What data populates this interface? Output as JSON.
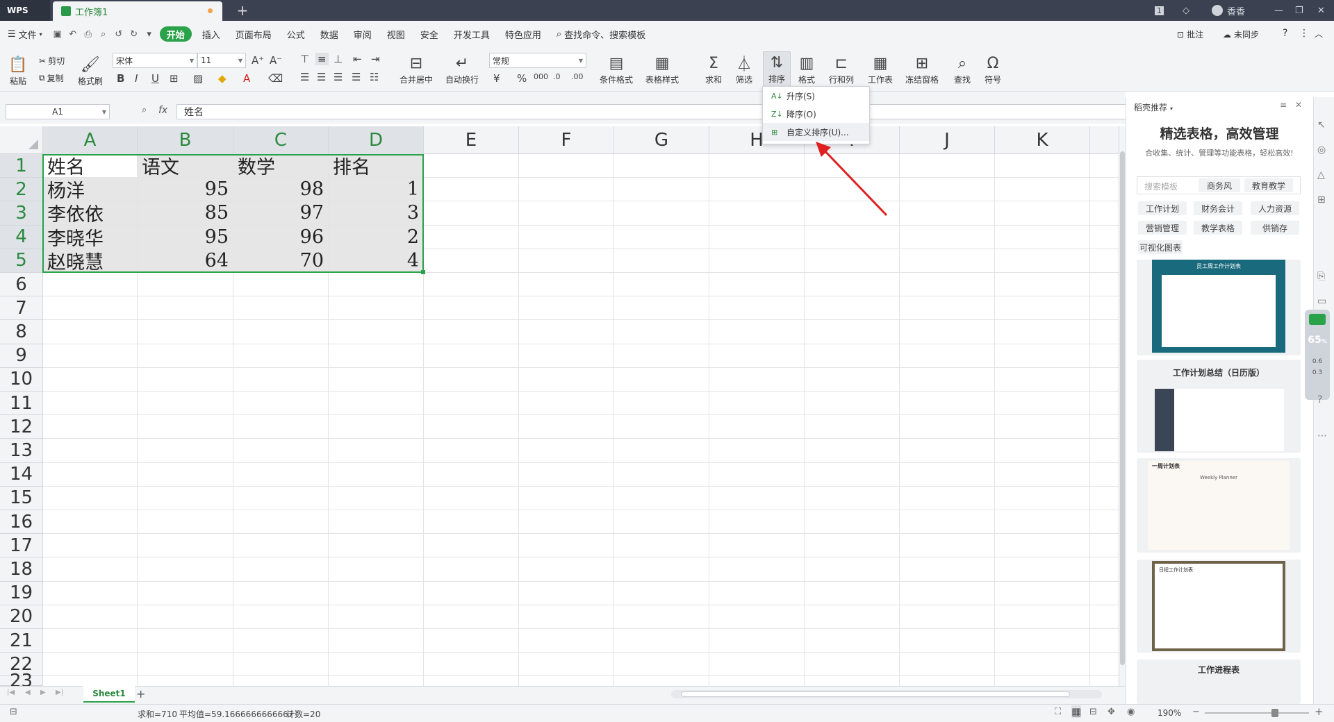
{
  "titlebar": {
    "app": "WPS",
    "doc_tab": "工作簿1",
    "new_tab": "+",
    "account": "香香",
    "badge": "1"
  },
  "menu": {
    "file": "文件",
    "tabs": [
      "开始",
      "插入",
      "页面布局",
      "公式",
      "数据",
      "审阅",
      "视图",
      "安全",
      "开发工具",
      "特色应用"
    ],
    "search": "查找命令、搜索模板",
    "comment": "批注",
    "sync": "未同步"
  },
  "ribbon": {
    "paste": "粘贴",
    "cut": "剪切",
    "copy": "复制",
    "format_painter": "格式刷",
    "font_name": "宋体",
    "font_size": "11",
    "merge": "合并居中",
    "wrap": "自动换行",
    "number_format": "常规",
    "cond_format": "条件格式",
    "table_style": "表格样式",
    "sum": "求和",
    "filter": "筛选",
    "sort": "排序",
    "format": "格式",
    "rowcol": "行和列",
    "worksheet": "工作表",
    "freeze": "冻结窗格",
    "find": "查找",
    "symbol": "符号"
  },
  "sort_menu": {
    "asc": "升序(S)",
    "desc": "降序(O)",
    "custom": "自定义排序(U)..."
  },
  "formula": {
    "cell_ref": "A1",
    "fx": "fx",
    "content": "姓名"
  },
  "columns": [
    "A",
    "B",
    "C",
    "D",
    "E",
    "F",
    "G",
    "H",
    "I",
    "J",
    "K"
  ],
  "rows": [
    "1",
    "2",
    "3",
    "4",
    "5",
    "6",
    "7",
    "8",
    "9",
    "10",
    "11",
    "12",
    "13",
    "14",
    "15",
    "16",
    "17",
    "18",
    "19",
    "20",
    "21",
    "22",
    "23"
  ],
  "sheet": {
    "header": [
      "姓名",
      "语文",
      "数学",
      "排名"
    ],
    "data": [
      [
        "杨洋",
        "95",
        "98",
        "1"
      ],
      [
        "李依依",
        "85",
        "97",
        "3"
      ],
      [
        "李晓华",
        "95",
        "96",
        "2"
      ],
      [
        "赵晓慧",
        "64",
        "70",
        "4"
      ]
    ]
  },
  "panel": {
    "header": "稻壳推荐",
    "title": "精选表格，高效管理",
    "subtitle": "合收集、统计、管理等功能表格，轻松高效!",
    "search_placeholder": "搜索模板",
    "tags": [
      "商务风",
      "教育教学",
      "工作计划",
      "财务会计",
      "人力资源",
      "营销管理",
      "教学表格",
      "供销存",
      "可视化图表"
    ],
    "templates": [
      "员工周工作计划表",
      "工作计划总结（日历版）",
      "一周计划表",
      "日程工作计划表",
      "工作进程表"
    ],
    "template_sub": "Weekly Planner"
  },
  "sheettabs": {
    "active": "Sheet1",
    "add": "+"
  },
  "status": {
    "sum": "求和=710",
    "avg": "平均值=59.1666666666667",
    "count": "计数=20",
    "zoom": "190%"
  },
  "side_meter": {
    "value": "65",
    "unit": "%",
    "up": "0.6",
    "down": "0.3"
  }
}
